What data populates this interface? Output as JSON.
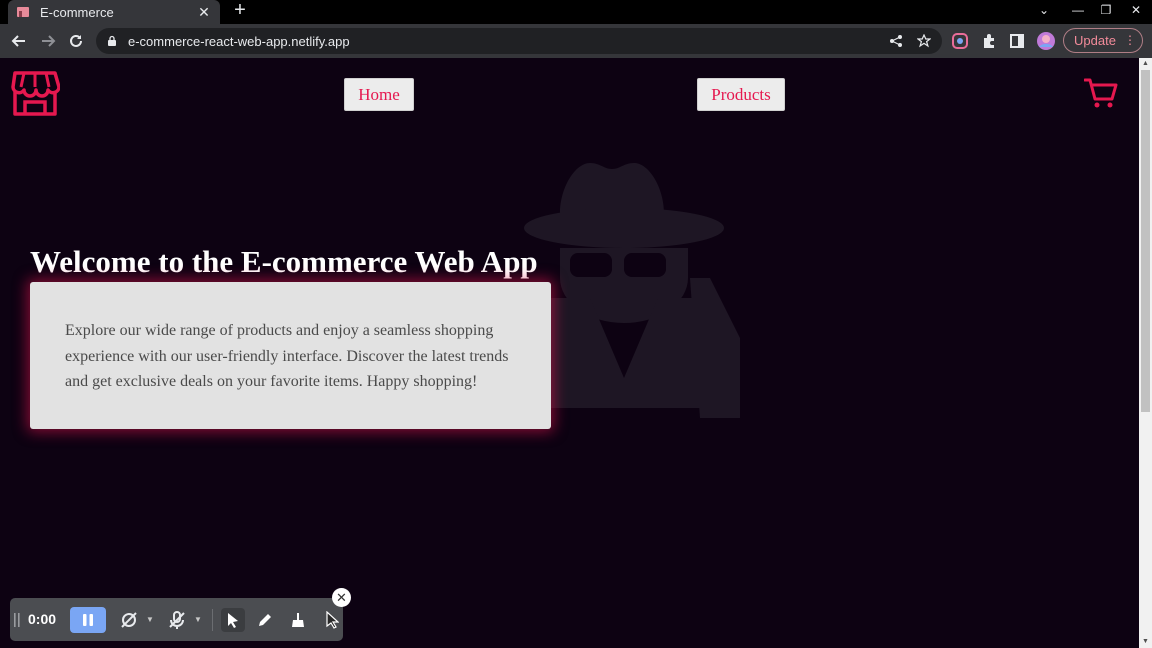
{
  "browser": {
    "tab_title": "E-commerce",
    "tab_close": "✕",
    "new_tab": "+",
    "url": "e-commerce-react-web-app.netlify.app",
    "update_label": "Update",
    "update_menu": "⋮",
    "window_controls": {
      "list": "⌄",
      "minimize": "—",
      "restore": "❐",
      "close": "✕"
    }
  },
  "header": {
    "nav": {
      "home_label": "Home",
      "products_label": "Products"
    },
    "logo_icon": "store-icon",
    "cart_icon": "cart-icon"
  },
  "hero": {
    "title": "Welcome to the E-commerce Web App",
    "body": "Explore our wide range of products and enjoy a seamless shopping experience with our user-friendly interface. Discover the latest trends and get exclusive deals on your favorite items. Happy shopping!",
    "background_icon": "spy-icon"
  },
  "recorder": {
    "time": "0:00",
    "close": "✕"
  },
  "colors": {
    "accent": "#e5184f",
    "page_bg": "#0d0212",
    "card_bg": "#e2e2e2",
    "button_bg": "#ececec"
  }
}
